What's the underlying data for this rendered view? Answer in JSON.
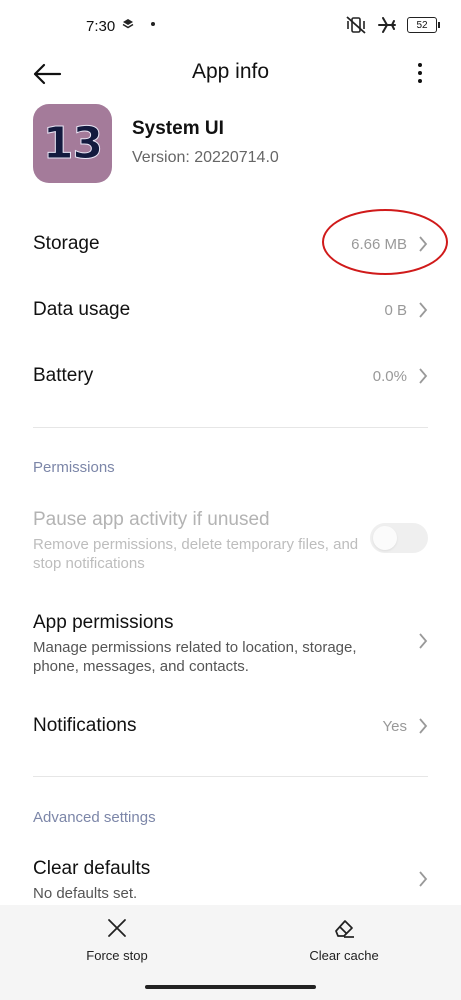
{
  "status_bar": {
    "time": "7:30",
    "battery": "52"
  },
  "header": {
    "title": "App info"
  },
  "app": {
    "name": "System UI",
    "version": "Version: 20220714.0",
    "icon_text": "13",
    "icon_bg": "#a47b9a"
  },
  "info_rows": [
    {
      "label": "Storage",
      "value": "6.66 MB"
    },
    {
      "label": "Data usage",
      "value": "0 B"
    },
    {
      "label": "Battery",
      "value": "0.0%"
    }
  ],
  "permissions": {
    "section_title": "Permissions",
    "pause": {
      "title": "Pause app activity if unused",
      "subtitle": "Remove permissions, delete temporary files, and stop notifications",
      "enabled": false
    },
    "app_permissions": {
      "title": "App permissions",
      "subtitle": "Manage permissions related to location, storage, phone, messages, and contacts."
    },
    "notifications": {
      "label": "Notifications",
      "value": "Yes"
    }
  },
  "advanced": {
    "section_title": "Advanced settings",
    "clear_defaults": {
      "title": "Clear defaults",
      "subtitle": "No defaults set."
    }
  },
  "bottom": {
    "force_stop": "Force stop",
    "clear_cache": "Clear cache"
  },
  "colors": {
    "annotation": "#d01a1a",
    "section": "#7c86a8"
  }
}
